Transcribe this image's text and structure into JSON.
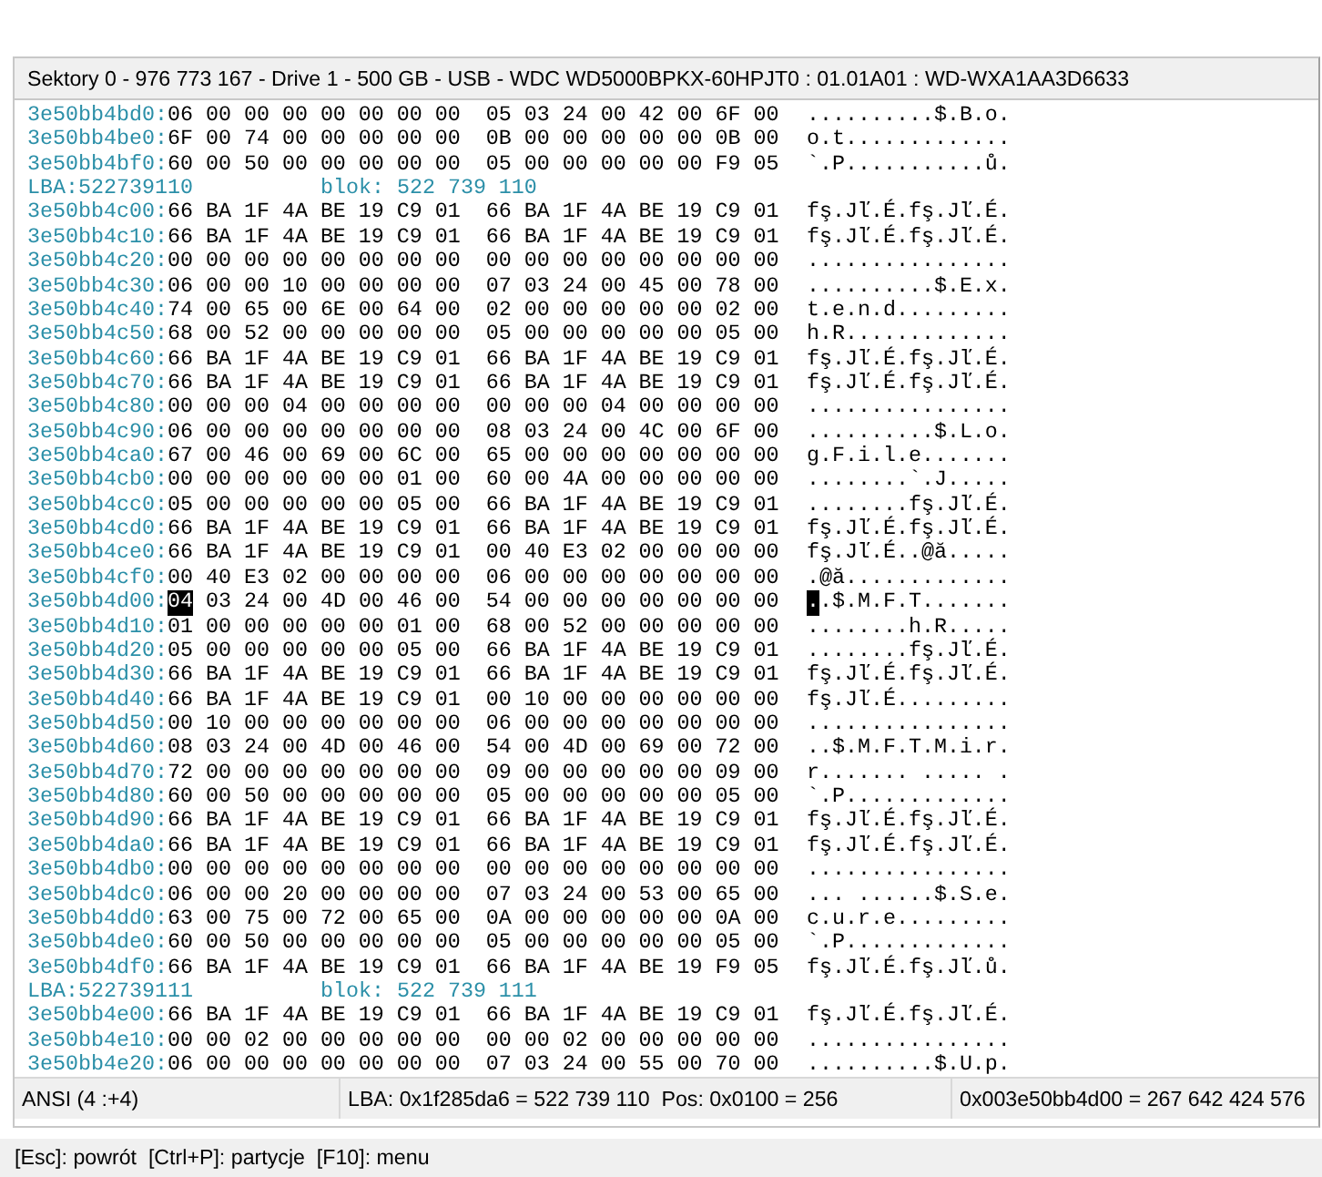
{
  "header": {
    "title": "Sektory 0 - 976 773 167 - Drive 1 - 500 GB - USB - WDC WD5000BPKX-60HPJT0 : 01.01A01 : WD-WXA1AA3D6633"
  },
  "rows": [
    {
      "kind": "hex",
      "address": "3e50bb4bd0:",
      "hex": "06 00 00 00 00 00 00 00  05 03 24 00 42 00 6F 00",
      "ascii": "..........$.B.o."
    },
    {
      "kind": "hex",
      "address": "3e50bb4be0:",
      "hex": "6F 00 74 00 00 00 00 00  0B 00 00 00 00 00 0B 00",
      "ascii": "o.t............."
    },
    {
      "kind": "hex",
      "address": "3e50bb4bf0:",
      "hex": "60 00 50 00 00 00 00 00  05 00 00 00 00 00 F9 05",
      "ascii": "`.P...........ů."
    },
    {
      "kind": "lba",
      "lba": "LBA:522739110",
      "block": "blok: 522 739 110"
    },
    {
      "kind": "hex",
      "address": "3e50bb4c00:",
      "hex": "66 BA 1F 4A BE 19 C9 01  66 BA 1F 4A BE 19 C9 01",
      "ascii": "fş.Jľ.É.fş.Jľ.É."
    },
    {
      "kind": "hex",
      "address": "3e50bb4c10:",
      "hex": "66 BA 1F 4A BE 19 C9 01  66 BA 1F 4A BE 19 C9 01",
      "ascii": "fş.Jľ.É.fş.Jľ.É."
    },
    {
      "kind": "hex",
      "address": "3e50bb4c20:",
      "hex": "00 00 00 00 00 00 00 00  00 00 00 00 00 00 00 00",
      "ascii": "................"
    },
    {
      "kind": "hex",
      "address": "3e50bb4c30:",
      "hex": "06 00 00 10 00 00 00 00  07 03 24 00 45 00 78 00",
      "ascii": "..........$.E.x."
    },
    {
      "kind": "hex",
      "address": "3e50bb4c40:",
      "hex": "74 00 65 00 6E 00 64 00  02 00 00 00 00 00 02 00",
      "ascii": "t.e.n.d........."
    },
    {
      "kind": "hex",
      "address": "3e50bb4c50:",
      "hex": "68 00 52 00 00 00 00 00  05 00 00 00 00 00 05 00",
      "ascii": "h.R............."
    },
    {
      "kind": "hex",
      "address": "3e50bb4c60:",
      "hex": "66 BA 1F 4A BE 19 C9 01  66 BA 1F 4A BE 19 C9 01",
      "ascii": "fş.Jľ.É.fş.Jľ.É."
    },
    {
      "kind": "hex",
      "address": "3e50bb4c70:",
      "hex": "66 BA 1F 4A BE 19 C9 01  66 BA 1F 4A BE 19 C9 01",
      "ascii": "fş.Jľ.É.fş.Jľ.É."
    },
    {
      "kind": "hex",
      "address": "3e50bb4c80:",
      "hex": "00 00 00 04 00 00 00 00  00 00 00 04 00 00 00 00",
      "ascii": "................"
    },
    {
      "kind": "hex",
      "address": "3e50bb4c90:",
      "hex": "06 00 00 00 00 00 00 00  08 03 24 00 4C 00 6F 00",
      "ascii": "..........$.L.o."
    },
    {
      "kind": "hex",
      "address": "3e50bb4ca0:",
      "hex": "67 00 46 00 69 00 6C 00  65 00 00 00 00 00 00 00",
      "ascii": "g.F.i.l.e......."
    },
    {
      "kind": "hex",
      "address": "3e50bb4cb0:",
      "hex": "00 00 00 00 00 00 01 00  60 00 4A 00 00 00 00 00",
      "ascii": "........`.J....."
    },
    {
      "kind": "hex",
      "address": "3e50bb4cc0:",
      "hex": "05 00 00 00 00 00 05 00  66 BA 1F 4A BE 19 C9 01",
      "ascii": "........fş.Jľ.É."
    },
    {
      "kind": "hex",
      "address": "3e50bb4cd0:",
      "hex": "66 BA 1F 4A BE 19 C9 01  66 BA 1F 4A BE 19 C9 01",
      "ascii": "fş.Jľ.É.fş.Jľ.É."
    },
    {
      "kind": "hex",
      "address": "3e50bb4ce0:",
      "hex": "66 BA 1F 4A BE 19 C9 01  00 40 E3 02 00 00 00 00",
      "ascii": "fş.Jľ.É..@ă....."
    },
    {
      "kind": "hex",
      "address": "3e50bb4cf0:",
      "hex": "00 40 E3 02 00 00 00 00  06 00 00 00 00 00 00 00",
      "ascii": ".@ă............."
    },
    {
      "kind": "cursor",
      "address": "3e50bb4d00:",
      "cursor_byte": "04",
      "hex": "03 24 00 4D 00 46 00  54 00 00 00 00 00 00 00",
      "cursor_char": ".",
      "ascii": ".$.M.F.T......."
    },
    {
      "kind": "hex",
      "address": "3e50bb4d10:",
      "hex": "01 00 00 00 00 00 01 00  68 00 52 00 00 00 00 00",
      "ascii": "........h.R....."
    },
    {
      "kind": "hex",
      "address": "3e50bb4d20:",
      "hex": "05 00 00 00 00 00 05 00  66 BA 1F 4A BE 19 C9 01",
      "ascii": "........fş.Jľ.É."
    },
    {
      "kind": "hex",
      "address": "3e50bb4d30:",
      "hex": "66 BA 1F 4A BE 19 C9 01  66 BA 1F 4A BE 19 C9 01",
      "ascii": "fş.Jľ.É.fş.Jľ.É."
    },
    {
      "kind": "hex",
      "address": "3e50bb4d40:",
      "hex": "66 BA 1F 4A BE 19 C9 01  00 10 00 00 00 00 00 00",
      "ascii": "fş.Jľ.É........."
    },
    {
      "kind": "hex",
      "address": "3e50bb4d50:",
      "hex": "00 10 00 00 00 00 00 00  06 00 00 00 00 00 00 00",
      "ascii": "................"
    },
    {
      "kind": "hex",
      "address": "3e50bb4d60:",
      "hex": "08 03 24 00 4D 00 46 00  54 00 4D 00 69 00 72 00",
      "ascii": "..$.M.F.T.M.i.r."
    },
    {
      "kind": "hex",
      "address": "3e50bb4d70:",
      "hex": "72 00 00 00 00 00 00 00  09 00 00 00 00 00 09 00",
      "ascii": "r....... ..... ."
    },
    {
      "kind": "hex",
      "address": "3e50bb4d80:",
      "hex": "60 00 50 00 00 00 00 00  05 00 00 00 00 00 05 00",
      "ascii": "`.P............."
    },
    {
      "kind": "hex",
      "address": "3e50bb4d90:",
      "hex": "66 BA 1F 4A BE 19 C9 01  66 BA 1F 4A BE 19 C9 01",
      "ascii": "fş.Jľ.É.fş.Jľ.É."
    },
    {
      "kind": "hex",
      "address": "3e50bb4da0:",
      "hex": "66 BA 1F 4A BE 19 C9 01  66 BA 1F 4A BE 19 C9 01",
      "ascii": "fş.Jľ.É.fş.Jľ.É."
    },
    {
      "kind": "hex",
      "address": "3e50bb4db0:",
      "hex": "00 00 00 00 00 00 00 00  00 00 00 00 00 00 00 00",
      "ascii": "................"
    },
    {
      "kind": "hex",
      "address": "3e50bb4dc0:",
      "hex": "06 00 00 20 00 00 00 00  07 03 24 00 53 00 65 00",
      "ascii": "... ......$.S.e."
    },
    {
      "kind": "hex",
      "address": "3e50bb4dd0:",
      "hex": "63 00 75 00 72 00 65 00  0A 00 00 00 00 00 0A 00",
      "ascii": "c.u.r.e........."
    },
    {
      "kind": "hex",
      "address": "3e50bb4de0:",
      "hex": "60 00 50 00 00 00 00 00  05 00 00 00 00 00 05 00",
      "ascii": "`.P............."
    },
    {
      "kind": "hex",
      "address": "3e50bb4df0:",
      "hex": "66 BA 1F 4A BE 19 C9 01  66 BA 1F 4A BE 19 F9 05",
      "ascii": "fş.Jľ.É.fş.Jľ.ů."
    },
    {
      "kind": "lba",
      "lba": "LBA:522739111",
      "block": "blok: 522 739 111"
    },
    {
      "kind": "hex",
      "address": "3e50bb4e00:",
      "hex": "66 BA 1F 4A BE 19 C9 01  66 BA 1F 4A BE 19 C9 01",
      "ascii": "fş.Jľ.É.fş.Jľ.É."
    },
    {
      "kind": "hex",
      "address": "3e50bb4e10:",
      "hex": "00 00 02 00 00 00 00 00  00 00 02 00 00 00 00 00",
      "ascii": "................"
    },
    {
      "kind": "hex",
      "address": "3e50bb4e20:",
      "hex": "06 00 00 00 00 00 00 00  07 03 24 00 55 00 70 00",
      "ascii": "..........$.U.p."
    }
  ],
  "status_bar": {
    "encoding": "ANSI (4 :+4)",
    "position": "LBA: 0x1f285da6 = 522 739 110  Pos: 0x0100 = 256",
    "offset": "0x003e50bb4d00 = 267 642 424 576"
  },
  "footer": {
    "hint": "[Esc]: powrót  [Ctrl+P]: partycje  [F10]: menu"
  }
}
